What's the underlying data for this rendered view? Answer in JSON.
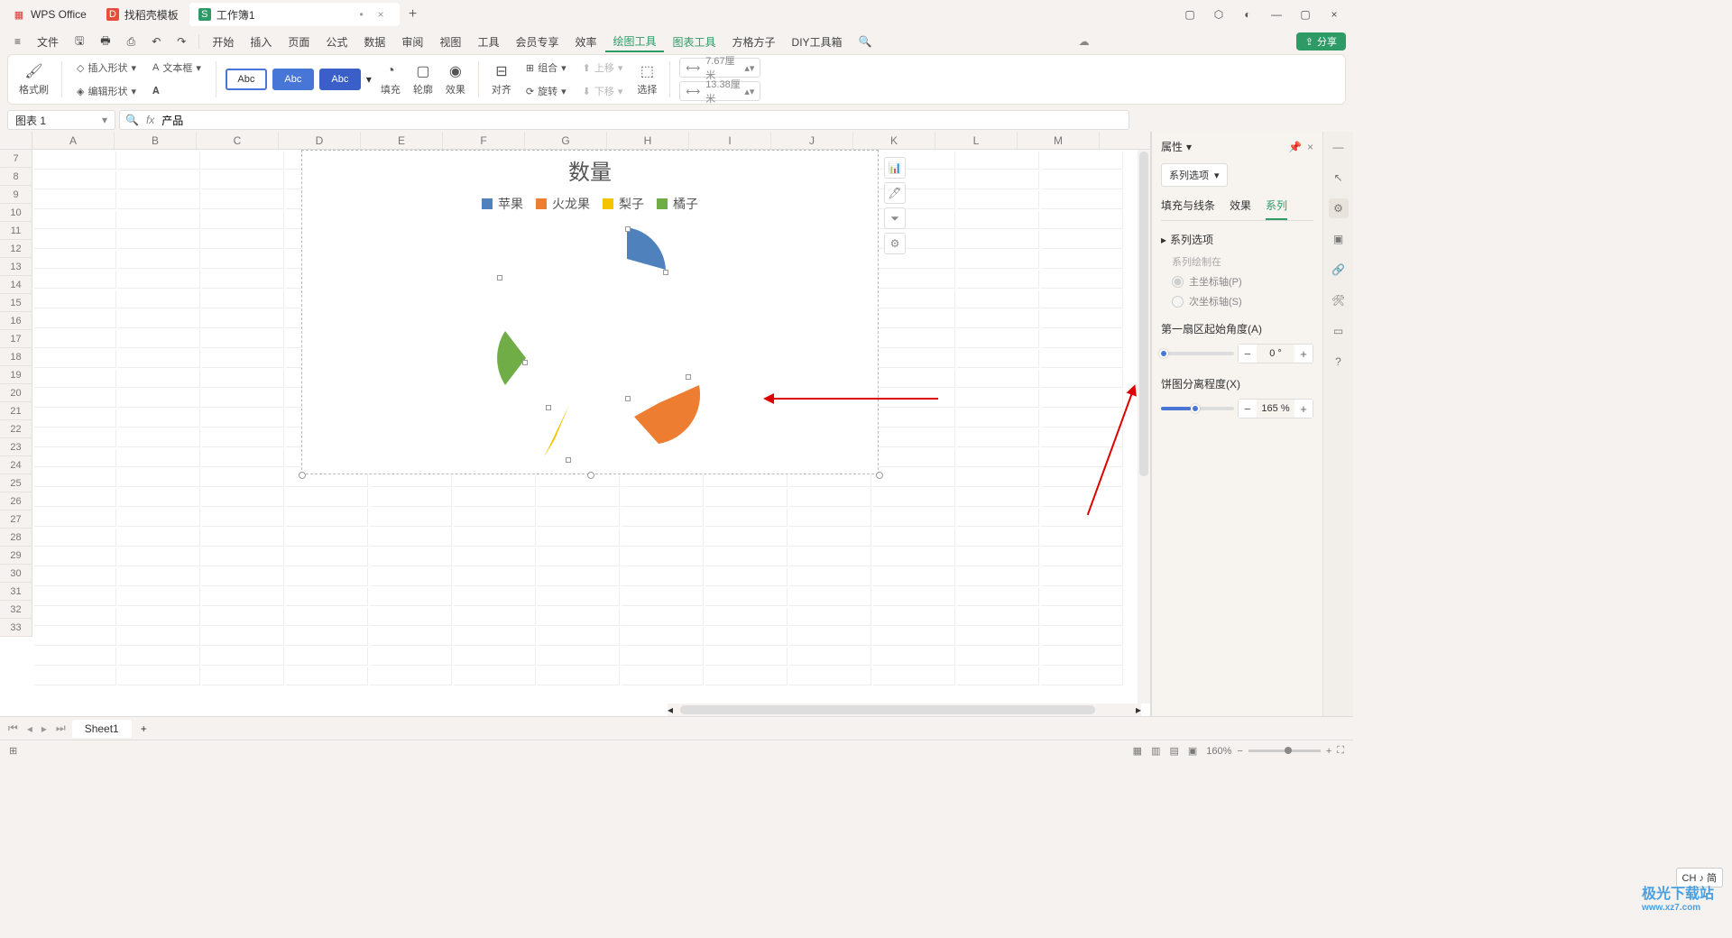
{
  "tabs": {
    "app": "WPS Office",
    "mid": "找稻壳模板",
    "doc": "工作簿1"
  },
  "menu": {
    "file": "文件",
    "items": [
      "开始",
      "插入",
      "页面",
      "公式",
      "数据",
      "审阅",
      "视图",
      "工具",
      "会员专享",
      "效率",
      "绘图工具",
      "图表工具",
      "方格方子",
      "DIY工具箱"
    ],
    "share": "分享"
  },
  "ribbon": {
    "formatBrush": "格式刷",
    "insertShape": "插入形状",
    "editShape": "编辑形状",
    "textBox": "文本框",
    "abc": "Abc",
    "fill": "填充",
    "outline": "轮廓",
    "effect": "效果",
    "align": "对齐",
    "group": "组合",
    "rotate": "旋转",
    "moveUp": "上移",
    "moveDown": "下移",
    "select": "选择",
    "w": "7.67厘米",
    "h": "13.38厘米"
  },
  "fbar": {
    "name": "图表 1",
    "value": "产品"
  },
  "columns": [
    "A",
    "B",
    "C",
    "D",
    "E",
    "F",
    "G",
    "H",
    "I",
    "J",
    "K",
    "L",
    "M"
  ],
  "rows_start": 7,
  "rows_end": 33,
  "chart": {
    "title": "数量",
    "legend": [
      {
        "label": "苹果",
        "color": "#4f81bd"
      },
      {
        "label": "火龙果",
        "color": "#ed7d31"
      },
      {
        "label": "梨子",
        "color": "#f2c500"
      },
      {
        "label": "橘子",
        "color": "#70ad47"
      }
    ]
  },
  "chart_data": {
    "type": "pie",
    "title": "数量",
    "series_name": "产品",
    "categories": [
      "苹果",
      "火龙果",
      "梨子",
      "橘子"
    ],
    "values": [
      15,
      25,
      10,
      30
    ],
    "colors": [
      "#4f81bd",
      "#ed7d31",
      "#f2c500",
      "#70ad47"
    ],
    "explosion_pct": 165,
    "first_slice_angle_deg": 0
  },
  "pane": {
    "title": "属性",
    "dropdown": "系列选项",
    "tabs": [
      "填充与线条",
      "效果",
      "系列"
    ],
    "active_tab": 2,
    "series_opts": "系列选项",
    "drawn_on": "系列绘制在",
    "primary": "主坐标轴(P)",
    "secondary": "次坐标轴(S)",
    "angle_label": "第一扇区起始角度(A)",
    "angle_val": "0",
    "angle_unit": "°",
    "explode_label": "饼图分离程度(X)",
    "explode_val": "165",
    "explode_unit": "%"
  },
  "sheet_tabs": {
    "name": "Sheet1"
  },
  "status": {
    "zoom": "160%",
    "ime": "CH ♪ 简"
  },
  "watermark": {
    "main": "极光下载站",
    "sub": "www.xz7.com"
  }
}
